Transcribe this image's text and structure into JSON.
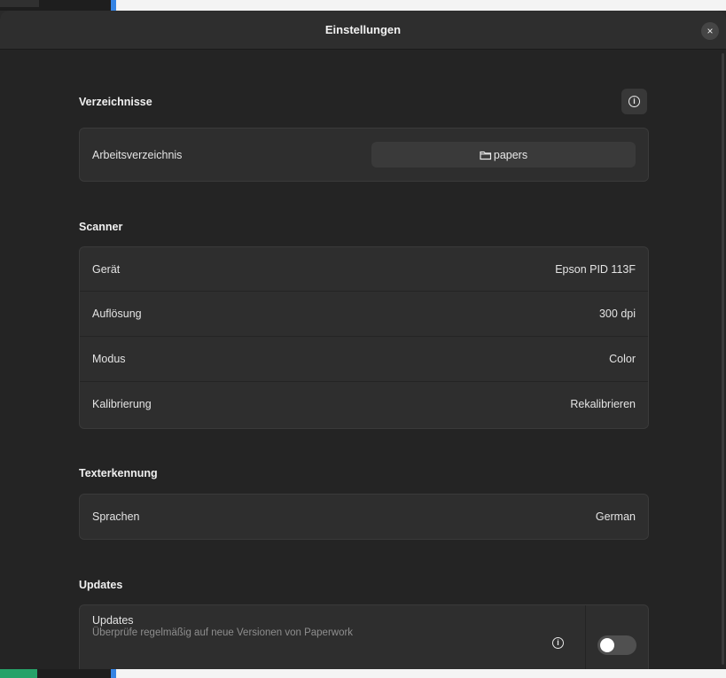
{
  "dialog": {
    "title": "Einstellungen",
    "close_glyph": "×"
  },
  "sections": {
    "directories": {
      "title": "Verzeichnisse",
      "info_icon": "info-icon",
      "work_dir_label": "Arbeitsverzeichnis",
      "work_dir_value": "papers",
      "folder_icon": "folder-icon"
    },
    "scanner": {
      "title": "Scanner",
      "rows": [
        {
          "label": "Gerät",
          "value": "Epson PID 113F"
        },
        {
          "label": "Auflösung",
          "value": "300 dpi"
        },
        {
          "label": "Modus",
          "value": "Color"
        },
        {
          "label": "Kalibrierung",
          "value": "Rekalibrieren"
        }
      ]
    },
    "ocr": {
      "title": "Texterkennung",
      "languages_label": "Sprachen",
      "languages_value": "German"
    },
    "updates": {
      "title": "Updates",
      "row_title": "Updates",
      "row_subtitle": "Überprüfe regelmäßig auf neue Versionen von Paperwork",
      "toggle_on": false
    }
  },
  "colors": {
    "accent": "#3584e4",
    "background": "#242424",
    "card": "#2e2e2e"
  }
}
